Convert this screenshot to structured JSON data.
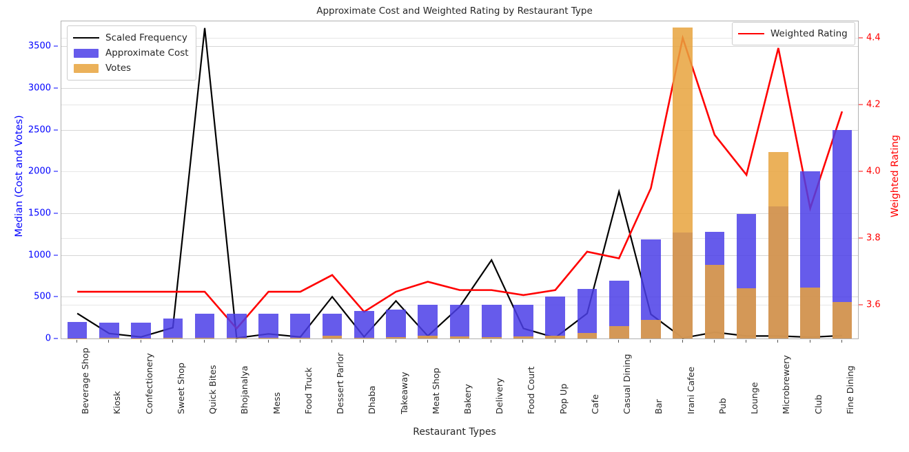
{
  "chart_data": {
    "type": "bar",
    "title": "Approximate Cost and Weighted Rating by Restaurant Type",
    "xlabel": "Restaurant Types",
    "ylabel": "Median (Cost and Votes)",
    "y2label": "Weighted Rating",
    "grid": true,
    "categories": [
      "Beverage Shop",
      "Kiosk",
      "Confectionery",
      "Sweet Shop",
      "Quick Bites",
      "Bhojanalya",
      "Mess",
      "Food Truck",
      "Dessert Parlor",
      "Dhaba",
      "Takeaway",
      "Meat Shop",
      "Bakery",
      "Delivery",
      "Food Court",
      "Pop Up",
      "Cafe",
      "Casual Dining",
      "Bar",
      "Irani Cafee",
      "Pub",
      "Lounge",
      "Microbrewery",
      "Club",
      "Fine Dining"
    ],
    "ylim": [
      0,
      3800
    ],
    "yticks": [
      0,
      500,
      1000,
      1500,
      2000,
      2500,
      3000,
      3500
    ],
    "y2lim": [
      3.5,
      4.45
    ],
    "y2ticks": [
      3.6,
      3.8,
      4.0,
      4.2,
      4.4
    ],
    "y2ticklabels": [
      "3.6",
      "3.8",
      "4.0",
      "4.2",
      "4.4"
    ],
    "series": [
      {
        "name": "Approximate Cost",
        "type": "bar",
        "color": "#4b3ee8",
        "axis": "left",
        "values": [
          200,
          190,
          190,
          240,
          300,
          300,
          300,
          300,
          300,
          330,
          350,
          400,
          400,
          400,
          400,
          500,
          590,
          690,
          1190,
          1270,
          1280,
          1495,
          1580,
          2000,
          2500
        ]
      },
      {
        "name": "Votes",
        "type": "bar",
        "color": "#e8a33d",
        "axis": "left",
        "values": [
          4,
          6,
          4,
          8,
          9,
          6,
          8,
          10,
          30,
          8,
          14,
          32,
          26,
          16,
          22,
          30,
          65,
          150,
          225,
          3730,
          880,
          600,
          2235,
          610,
          440
        ]
      },
      {
        "name": "Scaled Frequency",
        "type": "line",
        "color": "#000000",
        "axis": "left",
        "values": [
          300,
          60,
          18,
          130,
          3720,
          5,
          55,
          18,
          500,
          20,
          450,
          30,
          380,
          940,
          120,
          10,
          300,
          1760,
          290,
          5,
          75,
          30,
          30,
          15,
          35
        ]
      },
      {
        "name": "Weighted Rating",
        "type": "line",
        "color": "#ff0000",
        "axis": "right",
        "values": [
          3.64,
          3.64,
          3.64,
          3.64,
          3.64,
          3.53,
          3.64,
          3.64,
          3.69,
          3.58,
          3.64,
          3.67,
          3.645,
          3.645,
          3.63,
          3.645,
          3.76,
          3.74,
          3.95,
          4.4,
          4.11,
          3.99,
          4.37,
          3.89,
          4.18
        ]
      }
    ],
    "legend_left": {
      "position": "upper left",
      "entries": [
        {
          "label": "Scaled Frequency",
          "marker": "line",
          "color": "#000000"
        },
        {
          "label": "Approximate Cost",
          "marker": "patch",
          "color": "#4b3ee8"
        },
        {
          "label": "Votes",
          "marker": "patch",
          "color": "#e8a33d"
        }
      ]
    },
    "legend_right": {
      "position": "upper right",
      "entries": [
        {
          "label": "Weighted Rating",
          "marker": "line",
          "color": "#ff0000"
        }
      ]
    }
  }
}
